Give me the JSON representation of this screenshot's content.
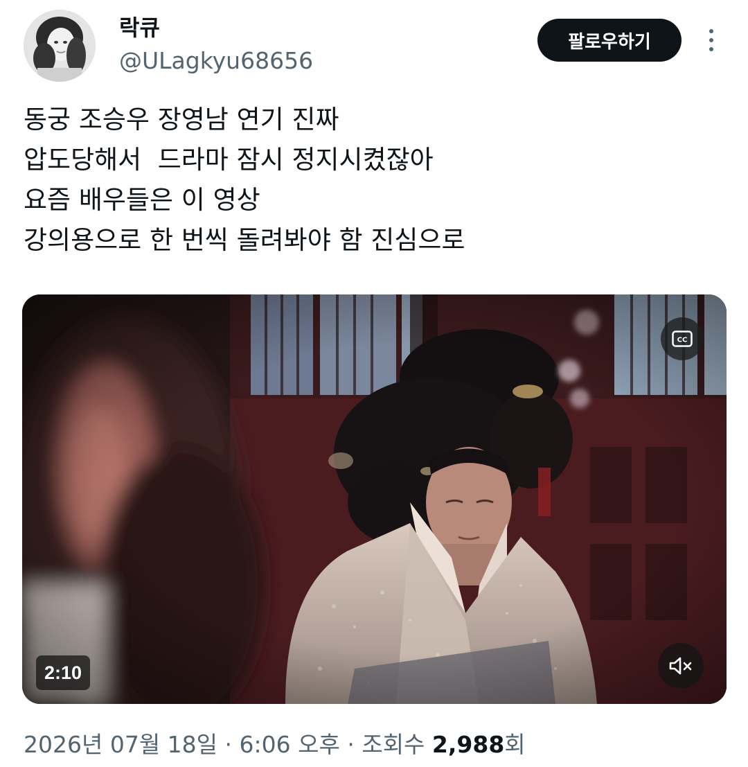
{
  "author": {
    "display_name": "락큐",
    "handle": "@ULagkyu68656",
    "avatar_icon": "profile-photo"
  },
  "follow_button": {
    "label": "팔로우하기"
  },
  "more_menu_icon": "more-vertical-icon",
  "tweet": {
    "lines": [
      "동궁 조승우 장영남 연기 진짜",
      "압도당해서  드라마 잠시 정지시켰잖아",
      "요즘 배우들은 이 영상",
      "강의용으로 한 번씩 돌려봐야 함 진심으로"
    ]
  },
  "video": {
    "duration": "2:10",
    "cc_label": "CC",
    "mute_icon": "volume-muted-icon"
  },
  "meta": {
    "date": "2026년 07월 18일",
    "separator": " · ",
    "time": "6:06 오후",
    "views_label": "조회수 ",
    "views_count": "2,988",
    "views_suffix": "회"
  },
  "colors": {
    "text_primary": "#0f1419",
    "text_secondary": "#536471",
    "button_bg": "#0f1419",
    "button_text": "#ffffff"
  }
}
